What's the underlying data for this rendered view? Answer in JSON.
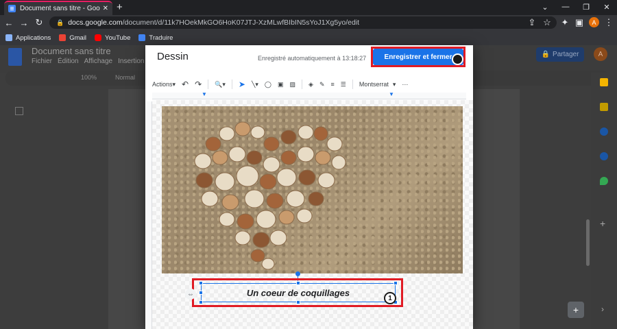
{
  "browser": {
    "tab_title": "Document sans titre - Google Do",
    "url_host": "docs.google.com",
    "url_path": "/document/d/11k7HOekMkGO6HoK07JTJ-XzMLwfBIbIN5sYoJ1Xg5yo/edit",
    "profile_initial": "A",
    "bookmarks": [
      {
        "label": "Applications",
        "icon": "apps-grid-icon",
        "color": "#8ab4f8"
      },
      {
        "label": "Gmail",
        "icon": "gmail-icon",
        "color": "#ea4335"
      },
      {
        "label": "YouTube",
        "icon": "youtube-icon",
        "color": "#ff0000"
      },
      {
        "label": "Traduire",
        "icon": "translate-icon",
        "color": "#4285f4"
      }
    ]
  },
  "docs": {
    "title": "Document sans titre",
    "menu": [
      "Fichier",
      "Édition",
      "Affichage",
      "Insertion"
    ],
    "zoom": "100%",
    "style": "Normal",
    "share_label": "Partager",
    "account_initial": "A"
  },
  "dialog": {
    "title": "Dessin",
    "autosave": "Enregistré automatiquement à 13:18:27",
    "save_button": "Enregistrer et fermer",
    "toolbar": {
      "actions": "Actions",
      "font": "Montserrat",
      "more": "⋯"
    },
    "textbox_text": "Un coeur de coquillages",
    "annotation_1": "1",
    "annotation_2": "2"
  },
  "colors": {
    "accent": "#1a73e8",
    "highlight": "#e01b24"
  }
}
